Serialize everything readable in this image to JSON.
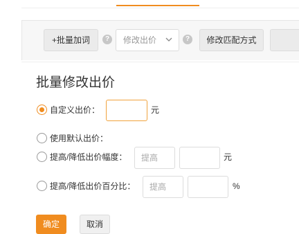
{
  "toolbar": {
    "bulk_add_label": "+批量加词",
    "help_mark": "?",
    "modify_bid_select": "修改出价",
    "modify_match_label": "修改匹配方式",
    "next_label": "删"
  },
  "panel": {
    "title": "批量修改出价",
    "options": [
      {
        "label": "自定义出价：",
        "checked": true,
        "unit": "元"
      },
      {
        "label": "使用默认出价：",
        "checked": false
      },
      {
        "label": "提高/降低出价幅度：",
        "checked": false,
        "placeholder": "提高",
        "unit": "元"
      },
      {
        "label": "提高/降低出价百分比：",
        "checked": false,
        "placeholder": "提高",
        "unit": "%"
      }
    ],
    "confirm_label": "确定",
    "cancel_label": "取消"
  },
  "colors": {
    "accent": "#f08c1f"
  }
}
